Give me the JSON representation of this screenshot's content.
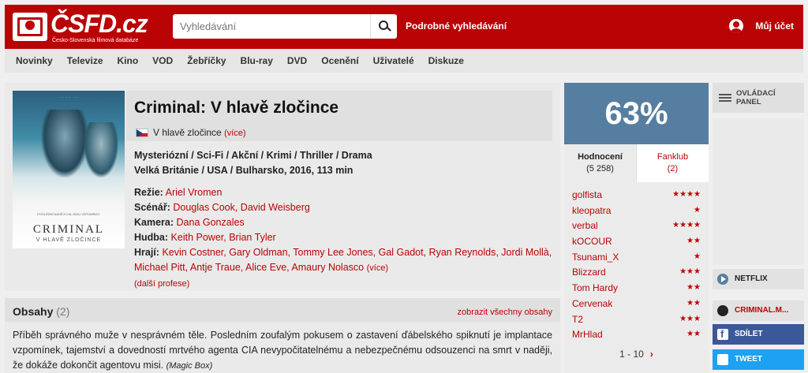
{
  "header": {
    "logo_text": "ČSFD.cz",
    "logo_subtitle": "Česko-Slovenská filmová databáze",
    "search_placeholder": "Vyhledávání",
    "advanced_search": "Podrobné vyhledávání",
    "account": "Můj účet"
  },
  "nav": [
    "Novinky",
    "Televize",
    "Kino",
    "VOD",
    "Žebříčky",
    "Blu-ray",
    "DVD",
    "Ocenění",
    "Uživatelé",
    "Diskuze"
  ],
  "film": {
    "title": "Criminal: V hlavě zločince",
    "alt_title": "V hlavě zločince",
    "alt_more": "(více)",
    "genres": "Mysteriózní / Sci-Fi / Akční / Krimi / Thriller / Drama",
    "origin": "Velká Británie / USA / Bulharsko, 2016, 113 min",
    "director_label": "Režie:",
    "director": "Ariel Vromen",
    "writers_label": "Scénář:",
    "writers": "Douglas Cook, David Weisberg",
    "camera_label": "Kamera:",
    "camera": "Dana Gonzales",
    "music_label": "Hudba:",
    "music": "Keith Power, Brian Tyler",
    "cast_label": "Hrají:",
    "cast": "Kevin Costner, Gary Oldman, Tommy Lee Jones, Gal Gadot, Ryan Reynolds, Jordi Mollà, Michael Pitt, Antje Traue, Alice Eve, Amaury Nolasco",
    "cast_more": "(více)",
    "more_people": "(další profese)"
  },
  "poster": {
    "tagline": "POSLEDNÍ NADĚJÍ CIA JSOU VZPOMÍNKY",
    "title": "CRIMINAL",
    "subtitle": "V HLAVĚ ZLOČINCE"
  },
  "plots": {
    "title": "Obsahy",
    "count": "(2)",
    "show_all": "zobrazit všechny obsahy",
    "text": "Příběh správného muže v nesprávném těle. Posledním zoufalým pokusem o zastavení ďábelského spiknutí je implantace vzpomínek, tajemství a dovedností mrtvého agenta CIA nevypočitatelnému a nebezpečnému odsouzenci na smrt v naději, že dokáže dokončit agentovu misi.",
    "source": "(Magic Box)"
  },
  "rating": {
    "score": "63%",
    "tab_ratings": "Hodnocení",
    "tab_ratings_count": "(5 258)",
    "tab_fanclub": "Fanklub",
    "tab_fanclub_count": "(2)",
    "users": [
      {
        "name": "golfista",
        "stars": "★★★★"
      },
      {
        "name": "kleopatra",
        "stars": "★"
      },
      {
        "name": "verbal",
        "stars": "★★★★"
      },
      {
        "name": "kOCOUR",
        "stars": "★★"
      },
      {
        "name": "Tsunami_X",
        "stars": "★"
      },
      {
        "name": "Blizzard",
        "stars": "★★★"
      },
      {
        "name": "Tom Hardy",
        "stars": "★★"
      },
      {
        "name": "Cervenak",
        "stars": "★★"
      },
      {
        "name": "T2",
        "stars": "★★★"
      },
      {
        "name": "MrHlad",
        "stars": "★★"
      }
    ],
    "pager": "1 - 10",
    "next": "›"
  },
  "side": {
    "control_panel_1": "OVLÁDACÍ",
    "control_panel_2": "PANEL",
    "netflix": "NETFLIX",
    "web": "CRIMINAL.M...",
    "share": "SDÍLET",
    "tweet": "TWEET"
  }
}
